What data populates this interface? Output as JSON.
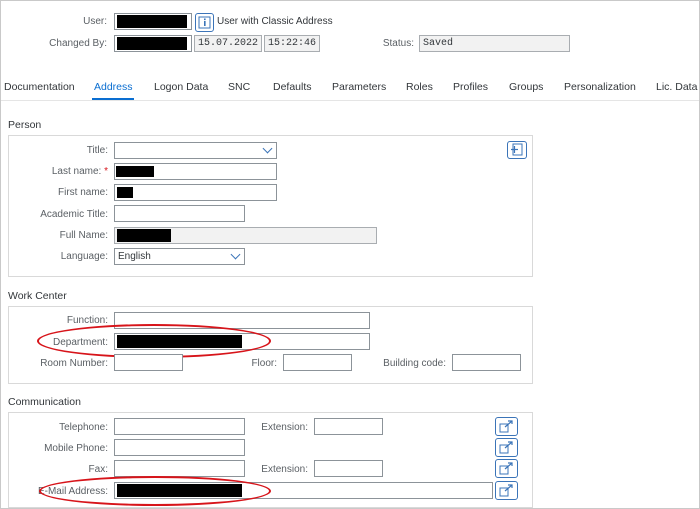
{
  "header": {
    "user_label": "User:",
    "classic_address_text": "User with Classic Address",
    "changed_by_label": "Changed By:",
    "changed_date": "15.07.2022",
    "changed_time": "15:22:46",
    "status_label": "Status:",
    "status_value": "Saved"
  },
  "tabs": [
    {
      "label": "Documentation"
    },
    {
      "label": "Address"
    },
    {
      "label": "Logon Data"
    },
    {
      "label": "SNC"
    },
    {
      "label": "Defaults"
    },
    {
      "label": "Parameters"
    },
    {
      "label": "Roles"
    },
    {
      "label": "Profiles"
    },
    {
      "label": "Groups"
    },
    {
      "label": "Personalization"
    },
    {
      "label": "Lic. Data"
    }
  ],
  "active_tab": "Address",
  "person": {
    "section_title": "Person",
    "title_label": "Title:",
    "title_value": "",
    "last_name_label": "Last name:",
    "required_marker": "*",
    "first_name_label": "First name:",
    "academic_title_label": "Academic Title:",
    "academic_title_value": "",
    "full_name_label": "Full Name:",
    "language_label": "Language:",
    "language_value": "English"
  },
  "work_center": {
    "section_title": "Work Center",
    "function_label": "Function:",
    "function_value": "",
    "department_label": "Department:",
    "room_number_label": "Room Number:",
    "room_number_value": "",
    "floor_label": "Floor:",
    "floor_value": "",
    "building_code_label": "Building code:",
    "building_code_value": ""
  },
  "communication": {
    "section_title": "Communication",
    "telephone_label": "Telephone:",
    "telephone_value": "",
    "extension_label": "Extension:",
    "extension_value": "",
    "mobile_phone_label": "Mobile Phone:",
    "mobile_phone_value": "",
    "fax_label": "Fax:",
    "fax_value": "",
    "fax_extension_label": "Extension:",
    "fax_extension_value": "",
    "email_label": "E-Mail Address:"
  },
  "colors": {
    "accent": "#0a6ed1",
    "highlight_oval": "#d7141a",
    "redaction": "#000000"
  },
  "icons": {
    "info": "info-icon",
    "person_action": "add-person-icon",
    "more_fields": "external-link-icon"
  }
}
